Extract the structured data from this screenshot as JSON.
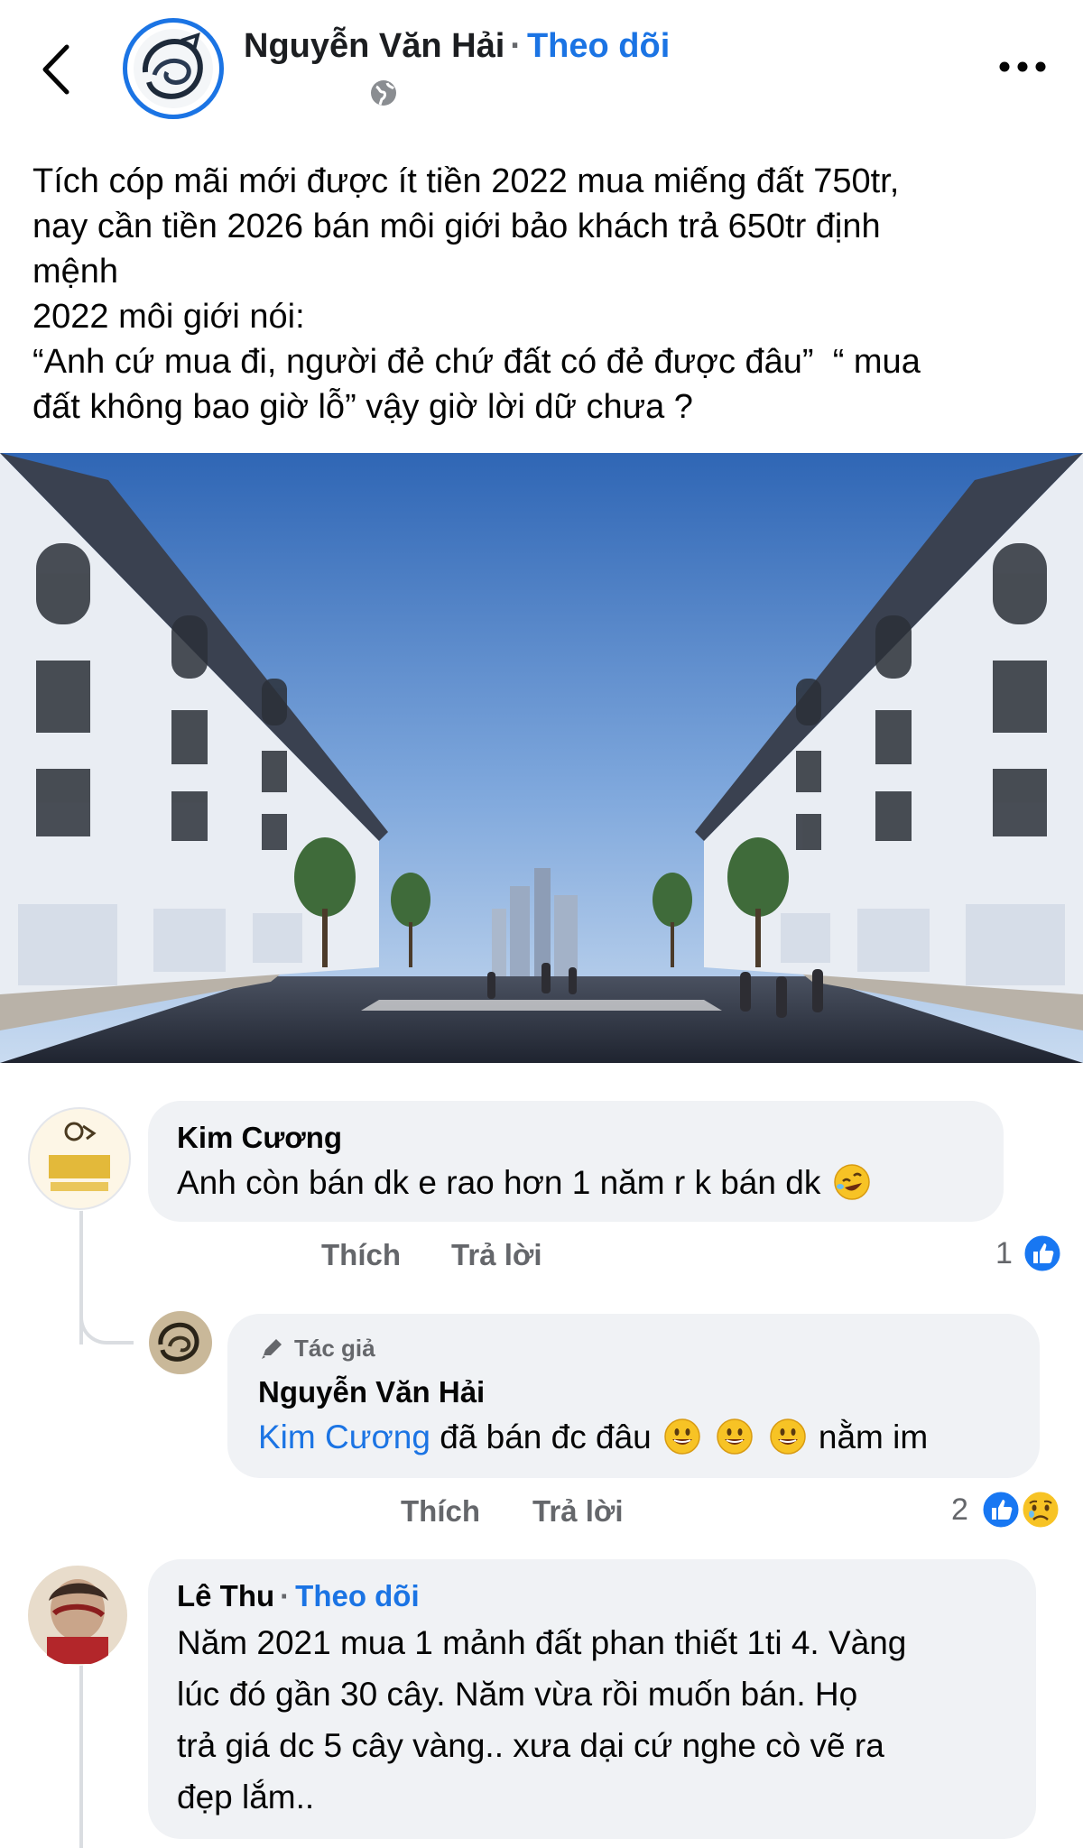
{
  "colors": {
    "accent": "#1b74e4",
    "muted": "#65676b",
    "bubble": "#f0f2f5",
    "text": "#050505",
    "like_blue": "#1877f2"
  },
  "header": {
    "author_name": "Nguyễn Văn Hải",
    "separator": "·",
    "follow_label": "Theo dõi",
    "icons": [
      "chevron-left-icon",
      "globe-icon",
      "more-horizontal-icon"
    ]
  },
  "post": {
    "lines": [
      "Tích cóp mãi mới được ít tiền 2022 mua miếng đất 750tr,",
      "nay cần tiền 2026 bán môi giới bảo khách trả 650tr định",
      "mệnh",
      "2022 môi giới nói:",
      "“Anh cứ mua đi, người đẻ chứ đất có đẻ được đâu”  “ mua",
      "đất không bao giờ lỗ” vậy giờ lời dữ chưa ?"
    ]
  },
  "comments": [
    {
      "author": "Kim Cương",
      "text": "Anh còn bán dk e rao hơn 1 năm r k bán dk",
      "emoji": [
        "rolling-on-floor-laughing"
      ],
      "like_label": "Thích",
      "reply_label": "Trả lời",
      "reaction_count": "1",
      "reactions": [
        "like"
      ]
    },
    {
      "author_badge": "Tác giả",
      "author": "Nguyễn Văn Hải",
      "mention": "Kim Cương",
      "text_before": "đã bán đc đâu",
      "emoji": [
        "grinning-face",
        "grinning-face",
        "grinning-face"
      ],
      "text_after": "nằm im",
      "like_label": "Thích",
      "reply_label": "Trả lời",
      "reaction_count": "2",
      "reactions": [
        "like",
        "sad"
      ]
    },
    {
      "author": "Lê Thu",
      "separator": "·",
      "follow_label": "Theo dõi",
      "lines": [
        "Năm 2021 mua 1 mảnh đất phan thiết 1ti 4. Vàng",
        "lúc đó gần 30 cây.  Năm vừa rồi muốn bán. Họ",
        "trả giá dc 5 cây vàng.. xưa dại cứ nghe cò vẽ ra",
        "đẹp lắm.."
      ]
    }
  ]
}
